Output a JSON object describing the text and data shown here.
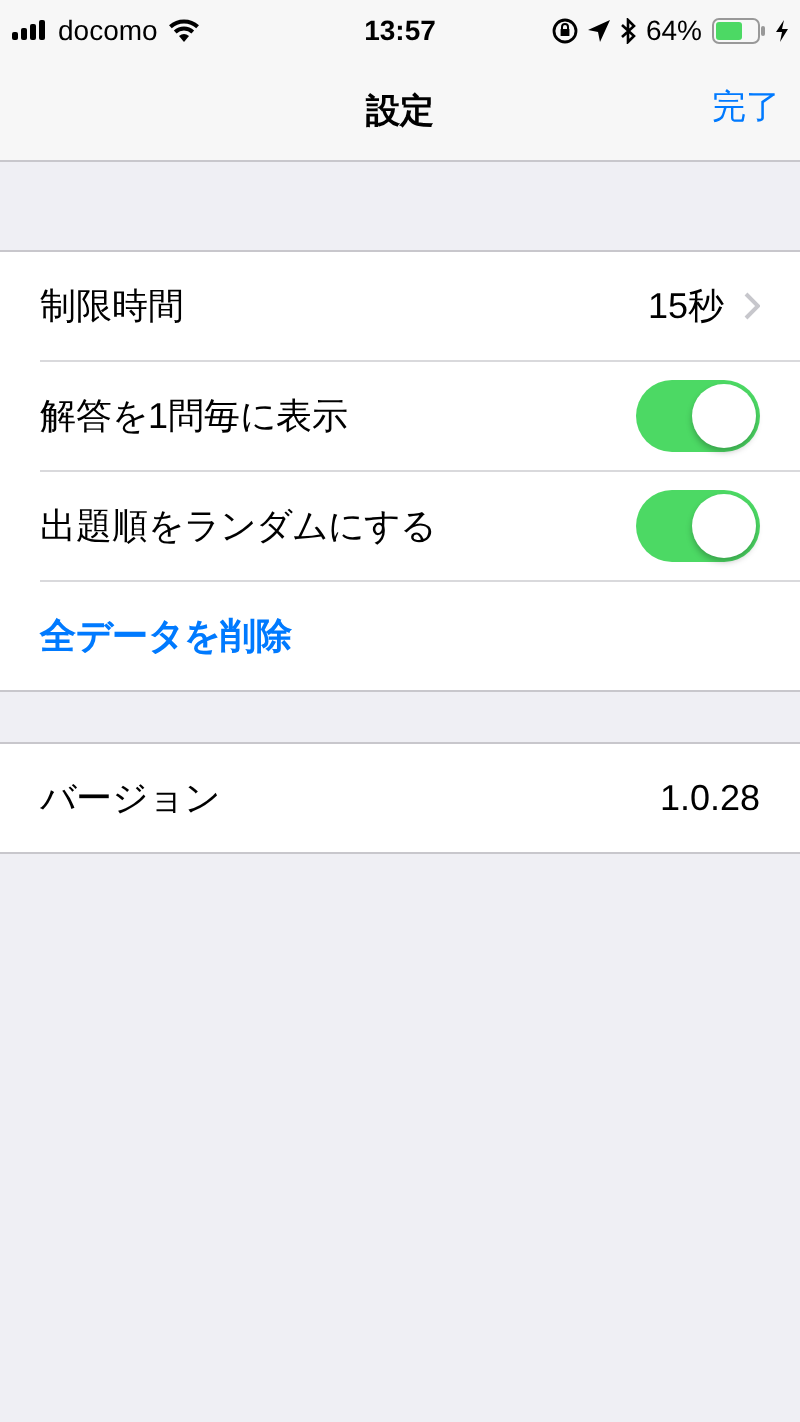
{
  "status_bar": {
    "carrier": "docomo",
    "time": "13:57",
    "battery": "64%"
  },
  "nav": {
    "title": "設定",
    "done": "完了"
  },
  "sections": [
    {
      "rows": [
        {
          "kind": "disclosure",
          "label": "制限時間",
          "value": "15秒"
        },
        {
          "kind": "toggle",
          "label": "解答を1問毎に表示",
          "on": true
        },
        {
          "kind": "toggle",
          "label": "出題順をランダムにする",
          "on": true
        },
        {
          "kind": "action",
          "label": "全データを削除"
        }
      ]
    },
    {
      "rows": [
        {
          "kind": "value",
          "label": "バージョン",
          "value": "1.0.28"
        }
      ]
    }
  ]
}
